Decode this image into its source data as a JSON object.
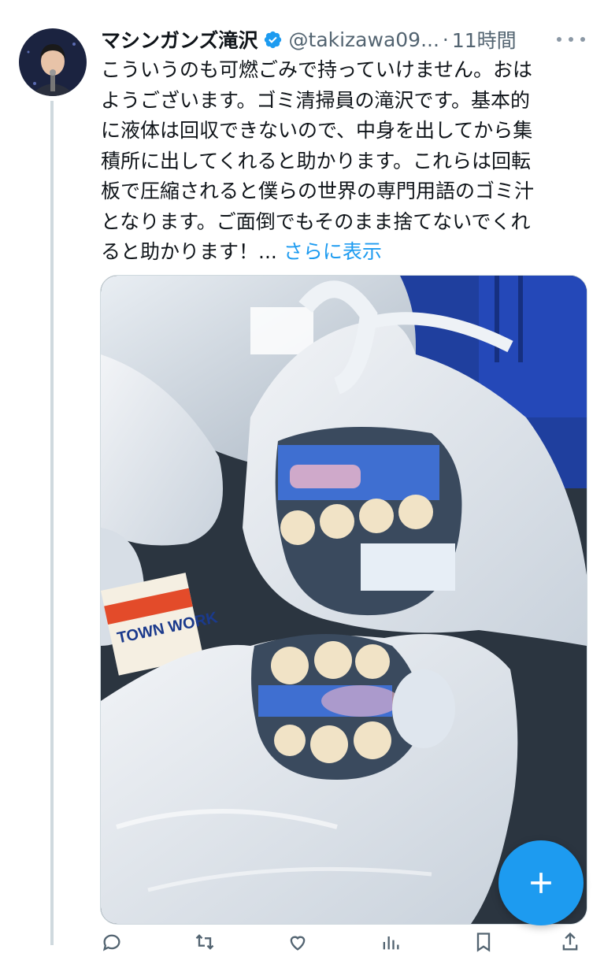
{
  "tweet": {
    "display_name": "マシンガンズ滝沢",
    "verified": true,
    "handle": "@takizawa09...",
    "separator": "·",
    "time": "11時間",
    "text_lines": [
      "こういうのも可燃ごみで持っていけません。おは",
      "ようございます。ゴミ清掃員の滝沢です。基本的",
      "に液体は回収できないので、中身を出してから集",
      "積所に出してくれると助かります。これらは回転",
      "板で圧縮されると僕らの世界の専門用語のゴミ汁",
      "となります。ご面倒でもそのまま捨てないでくれ",
      "ると助かります！..."
    ],
    "show_more": "さらに表示"
  },
  "media": {
    "image_label": "garbage-bags-with-bottled-drinks",
    "magazine_text": "TOWN WORK"
  },
  "actions": {
    "reply": "",
    "retweet": "",
    "like": "",
    "views": ""
  },
  "colors": {
    "accent": "#1d9bf0",
    "text": "#0f1419",
    "secondary": "#536471"
  },
  "icons": {
    "verified": "verified-badge-icon",
    "more": "more-dots-icon",
    "compose": "plus-icon"
  }
}
